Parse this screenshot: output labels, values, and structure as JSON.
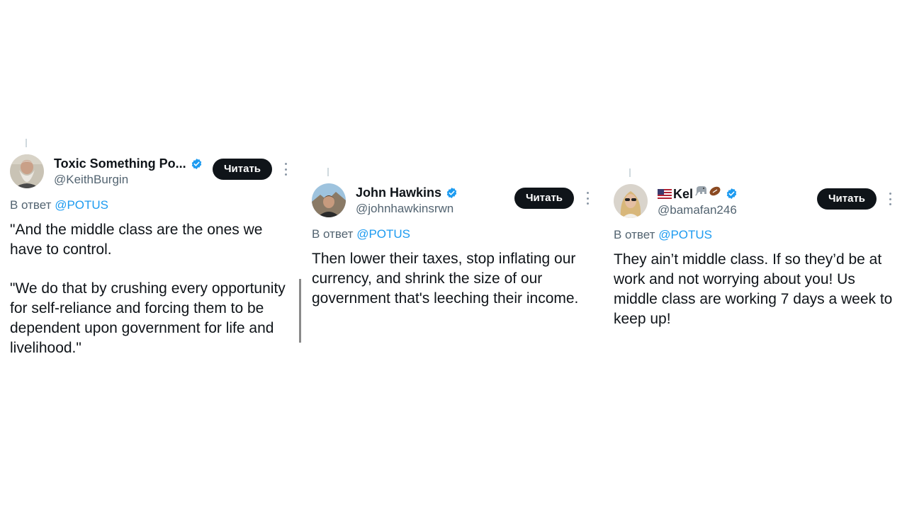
{
  "tweets": [
    {
      "display_name": "Toxic Something Po...",
      "handle": "@KeithBurgin",
      "follow_label": "Читать",
      "reply_prefix": "В ответ",
      "reply_mention": "@POTUS",
      "paragraphs": [
        "\"And the middle class are the ones we have to control.",
        "\"We do that by crushing every opportunity for self-reliance and forcing them to be dependent upon government for life and livelihood.\""
      ]
    },
    {
      "display_name": "John Hawkins",
      "handle": "@johnhawkinsrwn",
      "follow_label": "Читать",
      "reply_prefix": "В ответ",
      "reply_mention": "@POTUS",
      "paragraphs": [
        "Then lower their taxes, stop inflating our currency, and shrink the size of our government that's leeching their income."
      ]
    },
    {
      "display_name_text": "Kel",
      "name_icons": [
        "us-flag-icon",
        "elephant-icon",
        "football-icon"
      ],
      "handle": "@bamafan246",
      "follow_label": "Читать",
      "reply_prefix": "В ответ",
      "reply_mention": "@POTUS",
      "paragraphs": [
        "They ain’t middle class. If so they’d be at work and not worrying about you! Us middle class are working 7 days a week to keep up!"
      ]
    }
  ],
  "colors": {
    "verified": "#1d9bf0",
    "mention": "#1d9bf0",
    "secondary_text": "#536471",
    "button_bg": "#0f1419"
  }
}
